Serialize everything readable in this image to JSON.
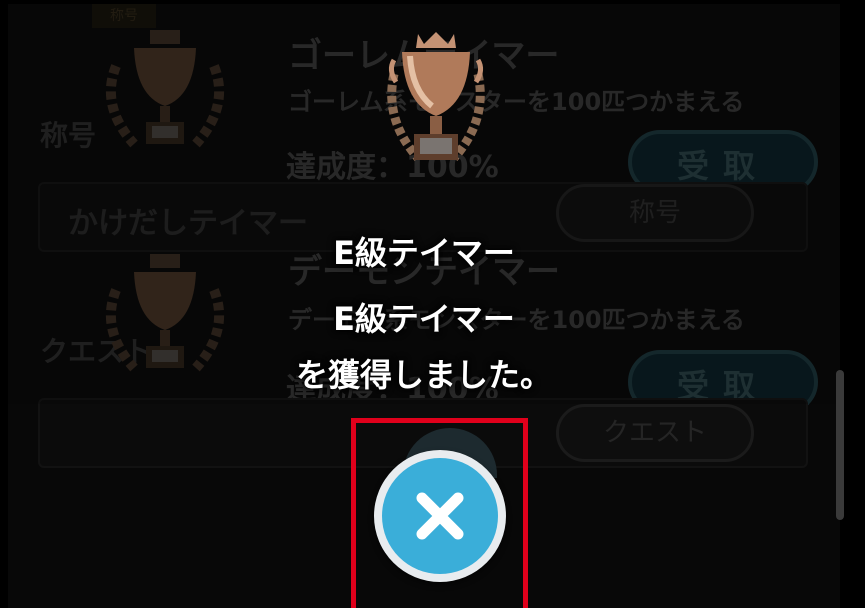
{
  "background": {
    "badge": "称号",
    "side_label_title": "称号",
    "side_label_quest": "クエスト",
    "title_bar_label": "かけだしテイマー",
    "quests": [
      {
        "title": "ゴーレムテイマー",
        "description": "ゴーレム系モンスターを100匹つかまえる",
        "progress": "達成度：100%",
        "claim_label": "受取",
        "pill_label": "称号"
      },
      {
        "title": "デーモンテイマー",
        "description": "デーモン系モンスターを100匹つかまえる",
        "progress": "達成度：100%",
        "claim_label": "受取",
        "pill_label": "クエスト"
      }
    ]
  },
  "dialog": {
    "line1": "E級テイマー",
    "line2": "E級テイマー",
    "line3": "を獲得しました。",
    "close_icon": "close-icon"
  },
  "colors": {
    "accent": "#3aaed9",
    "highlight": "#e0001b",
    "trophy_bronze": "#b07a5a"
  }
}
